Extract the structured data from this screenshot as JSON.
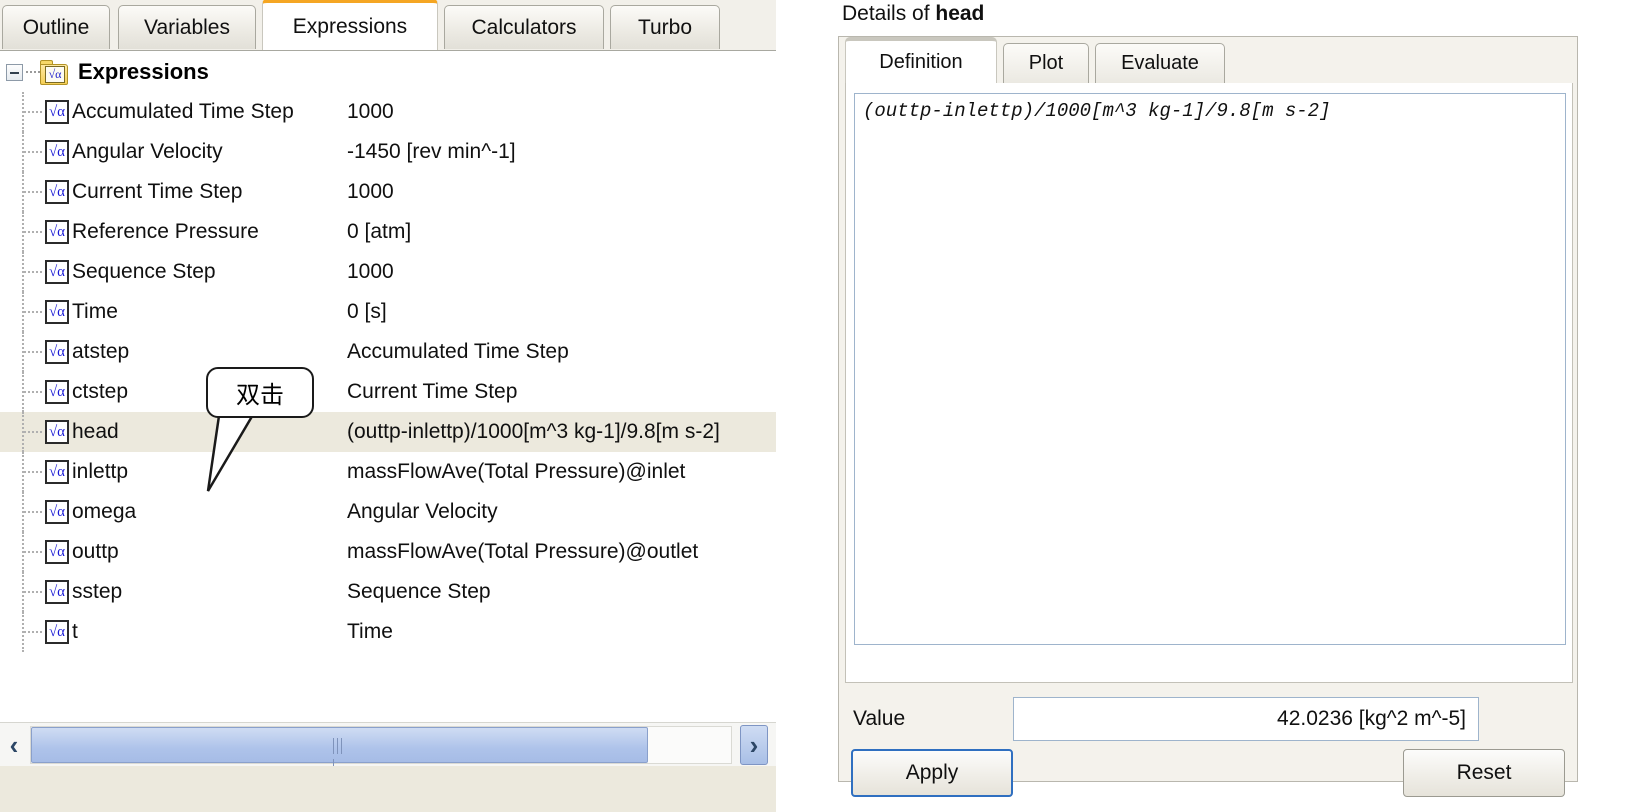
{
  "left_panel": {
    "tabs": [
      {
        "label": "Outline",
        "active": false
      },
      {
        "label": "Variables",
        "active": false
      },
      {
        "label": "Expressions",
        "active": true
      },
      {
        "label": "Calculators",
        "active": false
      },
      {
        "label": "Turbo",
        "active": false
      }
    ],
    "tree": {
      "root_label": "Expressions",
      "root_icon": "expressions-folder-icon",
      "expander_state": "expanded",
      "items": [
        {
          "name": "Accumulated Time Step",
          "value": "1000"
        },
        {
          "name": "Angular Velocity",
          "value": "-1450 [rev min^-1]"
        },
        {
          "name": "Current Time Step",
          "value": "1000"
        },
        {
          "name": "Reference Pressure",
          "value": "0 [atm]"
        },
        {
          "name": "Sequence Step",
          "value": "1000"
        },
        {
          "name": "Time",
          "value": "0 [s]"
        },
        {
          "name": "atstep",
          "value": "Accumulated Time Step"
        },
        {
          "name": "ctstep",
          "value": "Current Time Step"
        },
        {
          "name": "head",
          "value": "(outtp-inlettp)/1000[m^3 kg-1]/9.8[m s-2]",
          "selected": true
        },
        {
          "name": "inlettp",
          "value": "massFlowAve(Total Pressure)@inlet"
        },
        {
          "name": "omega",
          "value": "Angular Velocity"
        },
        {
          "name": "outtp",
          "value": "massFlowAve(Total Pressure)@outlet"
        },
        {
          "name": "sstep",
          "value": "Sequence Step"
        },
        {
          "name": "t",
          "value": "Time"
        }
      ]
    },
    "callout": {
      "text": "双击"
    },
    "scrollbar": {
      "left_arrow": "‹",
      "right_arrow": "›"
    }
  },
  "right_panel": {
    "title_prefix": "Details of ",
    "title_name": "head",
    "tabs": [
      {
        "label": "Definition",
        "active": true
      },
      {
        "label": "Plot",
        "active": false
      },
      {
        "label": "Evaluate",
        "active": false
      }
    ],
    "definition": {
      "expression": "(outtp-inlettp)/1000[m^3 kg-1]/9.8[m s-2]"
    },
    "value": {
      "label": "Value",
      "text": "42.0236 [kg^2 m^-5]"
    },
    "buttons": {
      "apply": "Apply",
      "reset": "Reset"
    }
  },
  "colors": {
    "tab_accent": "#f5a623",
    "selection_row": "#ece9dd",
    "scroll_thumb": "#aec3ea",
    "focus_border": "#2f6fc0"
  }
}
